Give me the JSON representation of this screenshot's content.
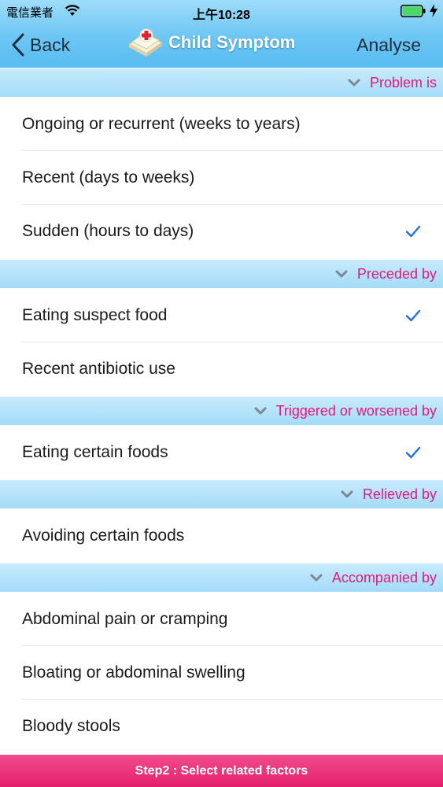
{
  "status_bar": {
    "carrier": "電信業者",
    "time": "上午10:28"
  },
  "nav": {
    "back_label": "Back",
    "title": "Child Symptom",
    "action_label": "Analyse"
  },
  "sections": [
    {
      "label": "Problem is",
      "items": [
        {
          "label": "Ongoing or recurrent (weeks to years)",
          "checked": false
        },
        {
          "label": "Recent (days to weeks)",
          "checked": false
        },
        {
          "label": "Sudden (hours to days)",
          "checked": true
        }
      ]
    },
    {
      "label": "Preceded by",
      "items": [
        {
          "label": "Eating suspect food",
          "checked": true
        },
        {
          "label": "Recent antibiotic use",
          "checked": false
        }
      ]
    },
    {
      "label": "Triggered or worsened by",
      "items": [
        {
          "label": "Eating certain foods",
          "checked": true
        }
      ]
    },
    {
      "label": "Relieved by",
      "items": [
        {
          "label": "Avoiding certain foods",
          "checked": false
        }
      ]
    },
    {
      "label": "Accompanied by",
      "items": [
        {
          "label": "Abdominal pain or cramping",
          "checked": false
        },
        {
          "label": "Bloating or abdominal swelling",
          "checked": false
        },
        {
          "label": "Bloody stools",
          "checked": false
        }
      ]
    }
  ],
  "footer": {
    "text": "Step2 : Select related factors"
  },
  "colors": {
    "accent": "#e5197a",
    "check": "#1e6fe0",
    "header_blue": "#6cc6f4"
  }
}
